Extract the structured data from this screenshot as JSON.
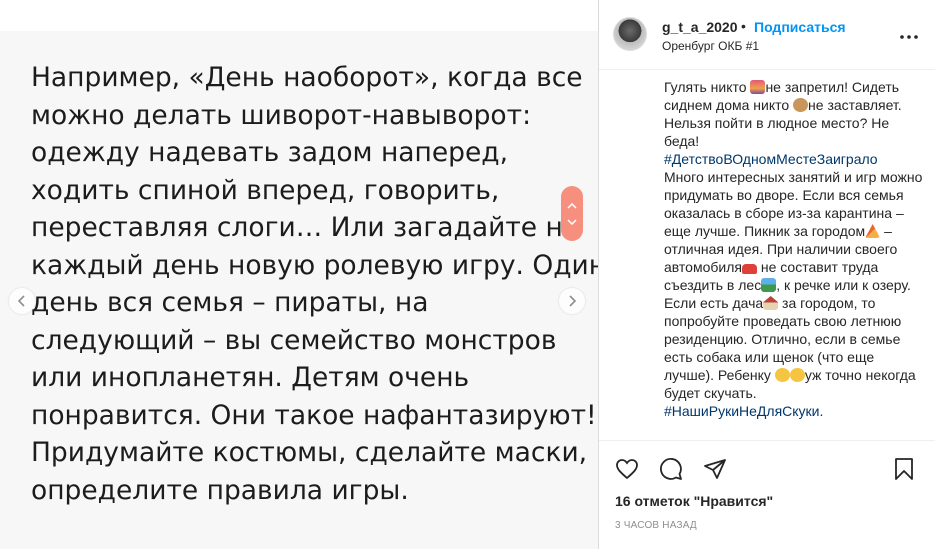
{
  "media": {
    "lines": [
      "Например, «День наоборот», когда все",
      "можно делать шиворот-навыворот:",
      "одежду надевать задом наперед,",
      "ходить спиной вперед, говорить,",
      "переставляя слоги… Или загадайте на",
      "каждый день новую ролевую игру. Один",
      "день вся семья – пираты, на",
      "следующий – вы семейство монстров",
      "или инопланетян. Детям очень",
      "понравится. Они такое нафантазируют!",
      "Придумайте костюмы, сделайте маски,",
      "определите правила игры."
    ],
    "prev_icon": "chevron-left-icon",
    "next_icon": "chevron-right-icon"
  },
  "header": {
    "username": "g_t_a_2020",
    "separator": "•",
    "follow_label": "Подписаться",
    "location": "Оренбург ОКБ #1",
    "more_icon": "more-dots-icon"
  },
  "caption": {
    "p1a": "Гулять никто ",
    "p1b": "не запретил! Сидеть сиднем дома никто ",
    "p1c": "не заставляет. Нельзя пойти в людное место? Не беда!",
    "tag1": "#ДетствоВОдномМестеЗаиграло",
    "p2a": "Много интересных занятий и игр можно придумать во дворе. Если вся семья оказалась в сборе из-за карантина – еще лучше. Пикник за городом",
    "p2b": " – отличная идея. При наличии своего автомобиля",
    "p2c": " не составит труда съездить в лес",
    "p2d": ", к речке или к озеру. Если есть дача",
    "p2e": " за городом, то попробуйте проведать свою летнюю резиденцию. Отлично, если в семье есть собака или щенок (что еще лучше). Ребенку ",
    "p2f": "уж точно некогда будет скучать.",
    "tag2": "#НашиРукиНеДляСкуки",
    "tag2_end": "."
  },
  "actions": {
    "like_icon": "heart-icon",
    "comment_icon": "comment-icon",
    "share_icon": "send-icon",
    "save_icon": "bookmark-icon"
  },
  "likes_text": "16 отметок \"Нравится\"",
  "time_text": "3 часов назад",
  "colors": {
    "link": "#0095f6",
    "hashtag": "#00376b",
    "scroll_pill": "#f68f7d"
  }
}
